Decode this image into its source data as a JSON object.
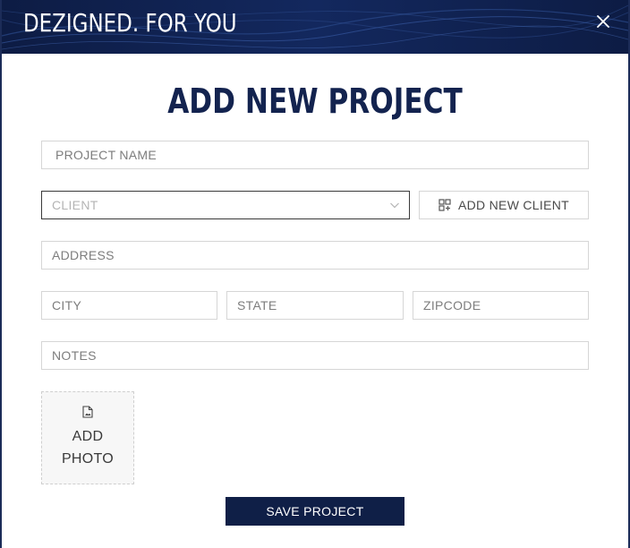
{
  "header": {
    "brand": "DEZIGNED. FOR YOU",
    "close_label": "X"
  },
  "modal": {
    "title": "ADD NEW PROJECT"
  },
  "form": {
    "project_name": {
      "value": "",
      "placeholder": "PROJECT NAME"
    },
    "client": {
      "selected": "CLIENT"
    },
    "add_client_label": "ADD NEW CLIENT",
    "address": {
      "value": "",
      "placeholder": "ADDRESS"
    },
    "city": {
      "value": "",
      "placeholder": "CITY"
    },
    "state": {
      "value": "",
      "placeholder": "STATE"
    },
    "zipcode": {
      "value": "",
      "placeholder": "ZIPCODE"
    },
    "notes": {
      "value": "",
      "placeholder": "NOTES"
    },
    "add_photo_label": "ADD PHOTO",
    "save_label": "SAVE PROJECT"
  },
  "icons": {
    "close": "close-icon",
    "chevron": "chevron-down-icon",
    "add_client": "grid-add-icon",
    "photo": "file-image-icon"
  },
  "colors": {
    "navy": "#0f1f47",
    "title": "#13234f",
    "border": "#d6d6d6",
    "placeholder": "#7d7d7d"
  }
}
